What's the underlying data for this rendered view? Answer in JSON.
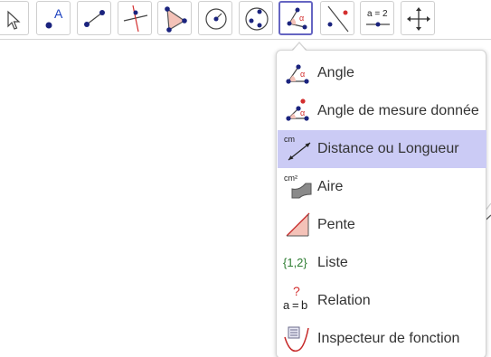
{
  "menu": {
    "items": [
      {
        "label": "Angle",
        "icon": "angle-icon"
      },
      {
        "label": "Angle de mesure donnée",
        "icon": "angle-fixed-icon"
      },
      {
        "label": "Distance ou Longueur",
        "icon": "distance-icon",
        "selected": true
      },
      {
        "label": "Aire",
        "icon": "area-icon"
      },
      {
        "label": "Pente",
        "icon": "slope-icon"
      },
      {
        "label": "Liste",
        "icon": "list-icon"
      },
      {
        "label": "Relation",
        "icon": "relation-icon"
      },
      {
        "label": "Inspecteur de fonction",
        "icon": "function-inspector-icon"
      }
    ],
    "icon_text": {
      "alpha": "α",
      "cm": "cm",
      "cm2": "cm²",
      "list": "{1,2}",
      "relation_q": "?",
      "relation_a": "a",
      "relation_eq": "=",
      "relation_b": "b"
    }
  },
  "toolbar": {
    "tools": [
      {
        "name": "move-tool",
        "icon": "cursor-icon"
      },
      {
        "name": "point-tool",
        "icon": "point-icon",
        "label": "A"
      },
      {
        "name": "line-tool",
        "icon": "line-icon"
      },
      {
        "name": "perpendicular-tool",
        "icon": "perpendicular-icon"
      },
      {
        "name": "polygon-tool",
        "icon": "polygon-icon"
      },
      {
        "name": "circle-tool",
        "icon": "circle-center-icon"
      },
      {
        "name": "circle-three-points-tool",
        "icon": "circle-three-points-icon"
      },
      {
        "name": "angle-tool",
        "icon": "angle-icon",
        "active": true
      },
      {
        "name": "reflect-tool",
        "icon": "reflect-icon"
      },
      {
        "name": "slider-tool",
        "icon": "slider-icon",
        "label": "a = 2"
      },
      {
        "name": "move-view-tool",
        "icon": "move-arrows-icon"
      }
    ]
  },
  "colors": {
    "active_border": "#6565c2",
    "selected_bg": "#cbcbf5",
    "point_blue": "#1a237e",
    "accent_red": "#d32f2f",
    "list_green": "#2e7d32",
    "text": "#333333"
  }
}
